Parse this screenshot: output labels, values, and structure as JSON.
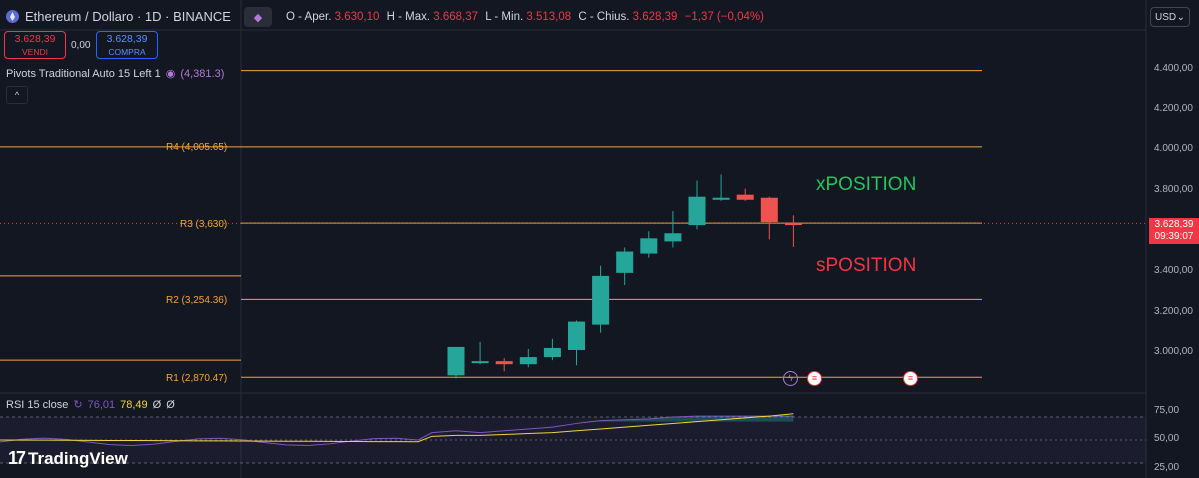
{
  "header": {
    "symbol": "Ethereum / Dollaro · 1D · BINANCE",
    "ohlc": {
      "open_label": "O",
      "open_prefix": "- Aper.",
      "open": "3.630,10",
      "high_label": "H",
      "high_prefix": "- Max.",
      "high": "3.668,37",
      "low_label": "L",
      "low_prefix": "- Min.",
      "low": "3.513,08",
      "close_label": "C",
      "close_prefix": "- Chius.",
      "close": "3.628,39",
      "change": "−1,37 (−0,04%)"
    },
    "currency": "USD"
  },
  "trade": {
    "sell_price": "3.628,39",
    "sell_label": "VENDI",
    "spread": "0,00",
    "buy_price": "3.628,39",
    "buy_label": "COMPRA"
  },
  "pivot_indicator": {
    "title": "Pivots Traditional Auto 15 Left 1",
    "value": "(4,381.3)",
    "collapse_glyph": "^"
  },
  "pivot_labels": {
    "r4": "R4 (4,005.65)",
    "r3": "R3 (3,630)",
    "r2": "R2 (3,254.36)",
    "r1": "R1 (2,870.47)"
  },
  "y_axis": {
    "labels": [
      "4.400,00",
      "4.200,00",
      "4.000,00",
      "3.800,00",
      "3.400,00",
      "3.200,00",
      "3.000,00"
    ],
    "rsi_labels": [
      "75,00",
      "50,00",
      "25,00"
    ]
  },
  "price_tag": {
    "price": "3.628,39",
    "countdown": "09:39:07"
  },
  "annotations": {
    "x_position": "xPOSITION",
    "s_position": "sPOSITION"
  },
  "rsi": {
    "title": "RSI 15 close",
    "value1": "76,01",
    "value2": "78,49",
    "value3": "Ø",
    "value4": "Ø"
  },
  "branding": {
    "logo": "TradingView",
    "logo_mark": "17"
  },
  "colors": {
    "background": "#131722",
    "up": "#26a69a",
    "down": "#ef5350",
    "pivot": "#f5a43a",
    "rsi_line": "#7e57c2",
    "rsi_ma": "#f2d53a",
    "x_position": "#22c55e",
    "s_position": "#f23645"
  },
  "chart_data": {
    "type": "candlestick",
    "price_axis": {
      "min": 2800,
      "max": 4500,
      "ticks": [
        3000,
        3200,
        3400,
        3800,
        4000,
        4200,
        4400
      ]
    },
    "pivot_levels": [
      {
        "name": "R4",
        "value": 4005.65
      },
      {
        "name": "R3",
        "value": 3630
      },
      {
        "name": "R2",
        "value": 3254.36
      },
      {
        "name": "R1",
        "value": 2870.47
      },
      {
        "name": "",
        "value": 4381.3
      }
    ],
    "candles": [
      {
        "o": 2880,
        "h": 3000,
        "l": 2865,
        "c": 3020
      },
      {
        "o": 2945,
        "h": 3045,
        "l": 2935,
        "c": 2950
      },
      {
        "o": 2950,
        "h": 2965,
        "l": 2900,
        "c": 2935
      },
      {
        "o": 2935,
        "h": 3010,
        "l": 2920,
        "c": 2970
      },
      {
        "o": 2970,
        "h": 3060,
        "l": 2955,
        "c": 3015
      },
      {
        "o": 3005,
        "h": 3150,
        "l": 2930,
        "c": 3145
      },
      {
        "o": 3130,
        "h": 3420,
        "l": 3090,
        "c": 3370
      },
      {
        "o": 3385,
        "h": 3510,
        "l": 3325,
        "c": 3490
      },
      {
        "o": 3480,
        "h": 3590,
        "l": 3460,
        "c": 3555
      },
      {
        "o": 3540,
        "h": 3690,
        "l": 3510,
        "c": 3580
      },
      {
        "o": 3620,
        "h": 3840,
        "l": 3600,
        "c": 3760
      },
      {
        "o": 3745,
        "h": 3870,
        "l": 3740,
        "c": 3755
      },
      {
        "o": 3770,
        "h": 3800,
        "l": 3740,
        "c": 3745
      },
      {
        "o": 3755,
        "h": 3760,
        "l": 3550,
        "c": 3635
      },
      {
        "o": 3630.1,
        "h": 3668.37,
        "l": 3513.08,
        "c": 3628.39
      }
    ],
    "last_price": 3628.39,
    "rsi": {
      "axis": {
        "min": 0,
        "max": 100,
        "ticks": [
          25,
          50,
          75
        ]
      },
      "rsi_values": [
        58,
        60,
        58,
        60,
        62,
        64,
        68,
        71,
        72,
        73,
        75,
        76,
        76,
        76,
        76,
        76
      ],
      "ma_values": [
        54,
        55,
        55,
        56,
        57,
        58,
        60,
        62,
        64,
        66,
        68,
        70,
        72,
        74,
        76,
        78.5
      ]
    }
  }
}
